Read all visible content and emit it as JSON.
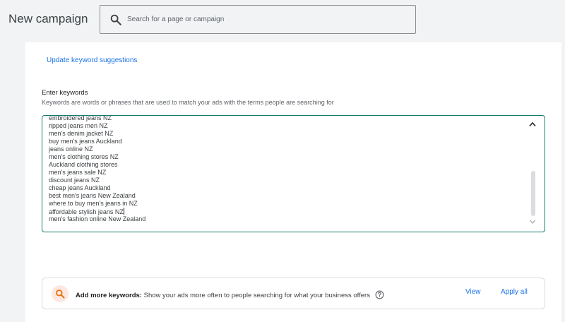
{
  "header": {
    "title": "New campaign",
    "search_placeholder": "Search for a page or campaign"
  },
  "keywords_section": {
    "update_link": "Update keyword suggestions",
    "heading": "Enter keywords",
    "help_text": "Keywords are words or phrases that are used to match your ads with the terms people are searching for",
    "entries": [
      "embroidered jeans NZ",
      "ripped jeans men NZ",
      "men's denim jacket NZ",
      "buy men's jeans Auckland",
      "jeans online NZ",
      "men's clothing stores NZ",
      "Auckland clothing stores",
      "men's jeans sale NZ",
      "discount jeans NZ",
      "cheap jeans Auckland",
      "best men's jeans New Zealand",
      "where to buy men's jeans in NZ",
      "affordable stylish jeans NZ",
      "men's fashion online New Zealand"
    ]
  },
  "suggestions": {
    "bold_label": "Add more keywords:",
    "text": "Show your ads more often to people searching for what your business offers",
    "view_label": "View",
    "apply_label": "Apply all"
  },
  "colors": {
    "link": "#1a73e8",
    "focus_border": "#137a6e",
    "suggest_icon": "#e8710a"
  }
}
